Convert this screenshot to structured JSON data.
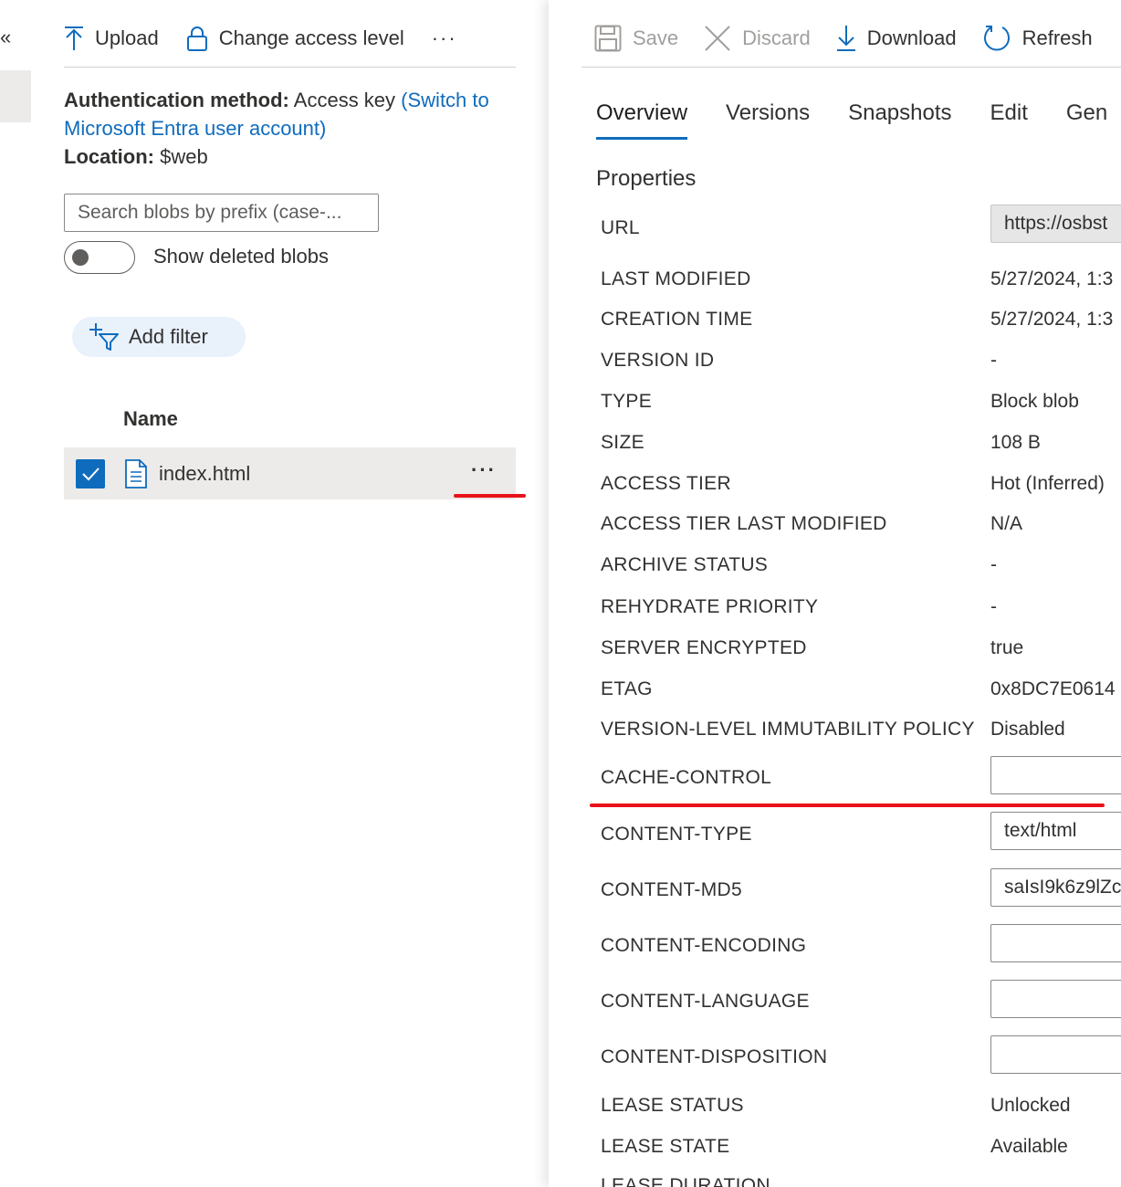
{
  "nav": {
    "collapse_glyph": "«"
  },
  "left_toolbar": {
    "upload": "Upload",
    "upload_icon": "upload-arrow",
    "change_access": "Change access level",
    "change_access_icon": "lock",
    "more": "···"
  },
  "auth": {
    "method_label": "Authentication method:",
    "method_value": "Access key",
    "switch_link": "(Switch to Microsoft Entra user account)",
    "location_label": "Location:",
    "location_value": "$web"
  },
  "search": {
    "placeholder": "Search blobs by prefix (case-..."
  },
  "toggle": {
    "label": "Show deleted blobs",
    "on": false
  },
  "filter": {
    "label": "Add filter"
  },
  "table": {
    "column_name": "Name",
    "rows": [
      {
        "name": "index.html",
        "checked": true,
        "more": "···"
      }
    ]
  },
  "right_toolbar": {
    "save": "Save",
    "discard": "Discard",
    "download": "Download",
    "refresh": "Refresh"
  },
  "tabs": [
    "Overview",
    "Versions",
    "Snapshots",
    "Edit",
    "Gen"
  ],
  "active_tab": "Overview",
  "properties": {
    "title": "Properties",
    "url_label": "URL",
    "url_value": "https://osbst",
    "last_modified_label": "LAST MODIFIED",
    "last_modified_value": "5/27/2024, 1:3",
    "creation_time_label": "CREATION TIME",
    "creation_time_value": "5/27/2024, 1:3",
    "version_id_label": "VERSION ID",
    "version_id_value": "-",
    "type_label": "TYPE",
    "type_value": "Block blob",
    "size_label": "SIZE",
    "size_value": "108 B",
    "access_tier_label": "ACCESS TIER",
    "access_tier_value": "Hot (Inferred)",
    "access_tier_lm_label": "ACCESS TIER LAST MODIFIED",
    "access_tier_lm_value": "N/A",
    "archive_status_label": "ARCHIVE STATUS",
    "archive_status_value": "-",
    "rehydrate_label": "REHYDRATE PRIORITY",
    "rehydrate_value": "-",
    "server_encrypted_label": "SERVER ENCRYPTED",
    "server_encrypted_value": "true",
    "etag_label": "ETAG",
    "etag_value": "0x8DC7E0614",
    "immutability_label": "VERSION-LEVEL IMMUTABILITY POLICY",
    "immutability_value": "Disabled",
    "cache_control_label": "CACHE-CONTROL",
    "cache_control_value": "",
    "content_type_label": "CONTENT-TYPE",
    "content_type_value": "text/html",
    "content_md5_label": "CONTENT-MD5",
    "content_md5_value": "saIsI9k6z9lZc",
    "content_encoding_label": "CONTENT-ENCODING",
    "content_encoding_value": "",
    "content_language_label": "CONTENT-LANGUAGE",
    "content_language_value": "",
    "content_disposition_label": "CONTENT-DISPOSITION",
    "content_disposition_value": "",
    "lease_status_label": "LEASE STATUS",
    "lease_status_value": "Unlocked",
    "lease_state_label": "LEASE STATE",
    "lease_state_value": "Available",
    "lease_duration_label": "LEASE DURATION"
  },
  "colors": {
    "accent": "#0f6cbd",
    "annotation_red": "#e8121a",
    "row_bg": "#edebe9",
    "filter_bg": "#e9f1fb"
  }
}
